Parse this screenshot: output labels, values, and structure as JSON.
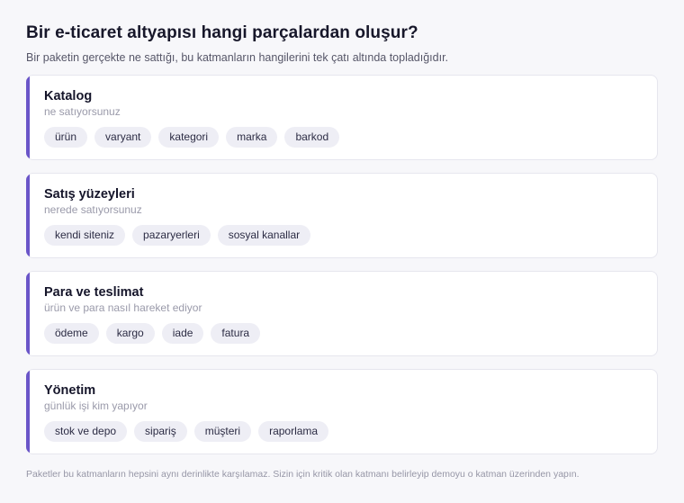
{
  "header": {
    "title": "Bir e-ticaret altyapısı hangi parçalardan oluşur?",
    "subtitle": "Bir paketin gerçekte ne sattığı, bu katmanların hangilerini tek çatı altında topladığıdır."
  },
  "layers": [
    {
      "title": "Katalog",
      "subtitle": "ne satıyorsunuz",
      "tags": [
        "ürün",
        "varyant",
        "kategori",
        "marka",
        "barkod"
      ]
    },
    {
      "title": "Satış yüzeyleri",
      "subtitle": "nerede satıyorsunuz",
      "tags": [
        "kendi siteniz",
        "pazaryerleri",
        "sosyal kanallar"
      ]
    },
    {
      "title": "Para ve teslimat",
      "subtitle": "ürün ve para nasıl hareket ediyor",
      "tags": [
        "ödeme",
        "kargo",
        "iade",
        "fatura"
      ]
    },
    {
      "title": "Yönetim",
      "subtitle": "günlük işi kim yapıyor",
      "tags": [
        "stok ve depo",
        "sipariş",
        "müşteri",
        "raporlama"
      ]
    }
  ],
  "footnote": "Paketler bu katmanların hepsini aynı derinlikte karşılamaz. Sizin için kritik olan katmanı belirleyip demoyu o katman üzerinden yapın.",
  "colors": {
    "accent": "#6a55c8",
    "tag_background": "#eeeef5",
    "page_background": "#f7f7fa"
  }
}
